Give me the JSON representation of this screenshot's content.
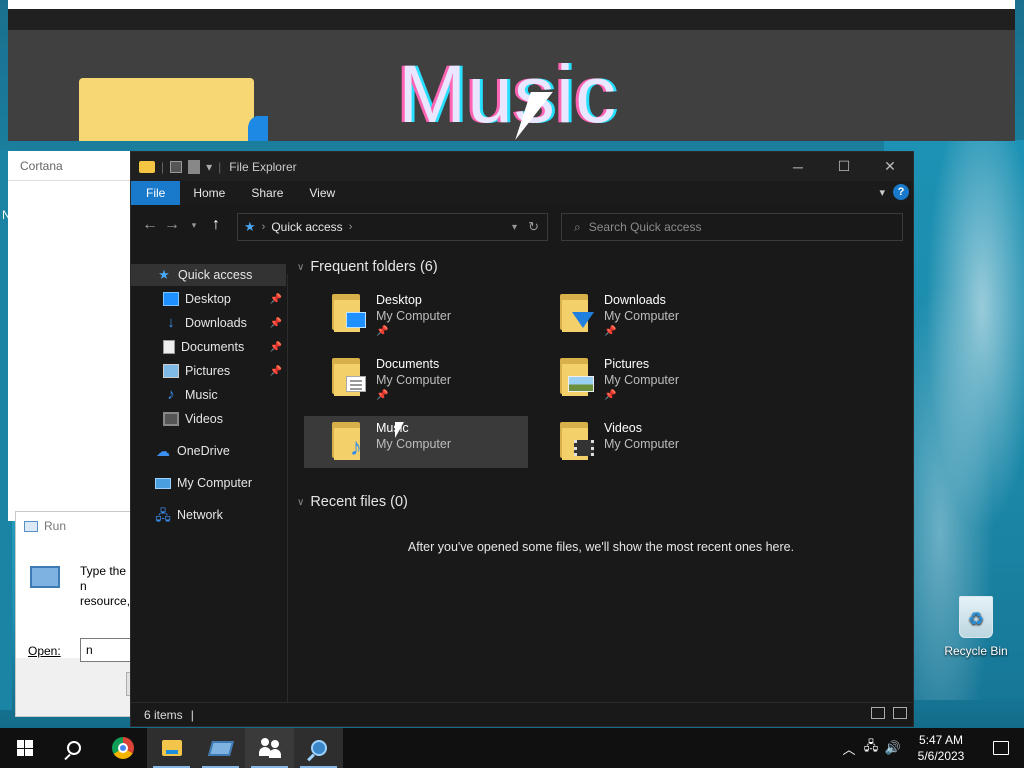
{
  "preview": {
    "big_text": "Music"
  },
  "cortana": {
    "title": "Cortana"
  },
  "desktop_stray": "N",
  "run_dialog": {
    "title": "Run",
    "description_line1": "Type the n",
    "description_line2": "resource,",
    "open_label": "Open:",
    "open_value": "n"
  },
  "explorer": {
    "title": "File Explorer",
    "window_buttons": {
      "minimize": "─",
      "maximize": "☐",
      "close": "✕"
    },
    "ribbon_tabs": [
      "File",
      "Home",
      "Share",
      "View"
    ],
    "help": "?",
    "address": {
      "location": "Quick access"
    },
    "search_placeholder": "Search Quick access",
    "nav": {
      "quick_access": "Quick access",
      "items": [
        {
          "label": "Desktop",
          "icon": "desktop-icon",
          "pinned": true
        },
        {
          "label": "Downloads",
          "icon": "downloads-icon",
          "pinned": true
        },
        {
          "label": "Documents",
          "icon": "documents-icon",
          "pinned": true
        },
        {
          "label": "Pictures",
          "icon": "pictures-icon",
          "pinned": true
        },
        {
          "label": "Music",
          "icon": "music-icon",
          "pinned": false
        },
        {
          "label": "Videos",
          "icon": "videos-icon",
          "pinned": false
        }
      ],
      "onedrive": "OneDrive",
      "my_computer": "My Computer",
      "network": "Network"
    },
    "frequent_header": "Frequent folders (6)",
    "folders": [
      {
        "name": "Desktop",
        "location": "My Computer",
        "pinned": true,
        "overlay": "desk"
      },
      {
        "name": "Downloads",
        "location": "My Computer",
        "pinned": true,
        "overlay": "down"
      },
      {
        "name": "Documents",
        "location": "My Computer",
        "pinned": true,
        "overlay": "doc"
      },
      {
        "name": "Pictures",
        "location": "My Computer",
        "pinned": true,
        "overlay": "pic"
      },
      {
        "name": "Music",
        "location": "My Computer",
        "pinned": false,
        "overlay": "mus"
      },
      {
        "name": "Videos",
        "location": "My Computer",
        "pinned": false,
        "overlay": "vid"
      }
    ],
    "recent_header": "Recent files (0)",
    "recent_empty_msg": "After you've opened some files, we'll show the most recent ones here.",
    "status": {
      "items": "6 items"
    }
  },
  "recycle_bin": {
    "label": "Recycle Bin"
  },
  "taskbar": {
    "time": "5:47 AM",
    "date": "5/6/2023"
  },
  "colors": {
    "accent": "#1979ca",
    "explorer_bg": "#191919"
  }
}
